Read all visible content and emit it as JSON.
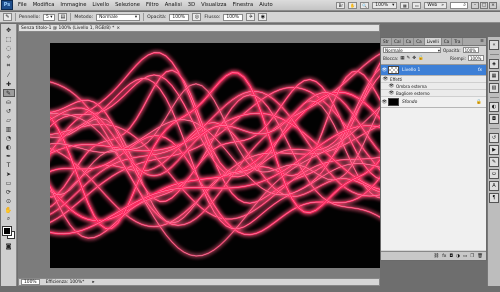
{
  "app": {
    "logo": "Ps",
    "menu": [
      "File",
      "Modifica",
      "Immagine",
      "Livello",
      "Selezione",
      "Filtro",
      "Analisi",
      "3D",
      "Visualizza",
      "Finestra",
      "Aiuto"
    ],
    "zoom_dropdown": "100%",
    "zoom_value": "100%",
    "workspace": "Web",
    "window_controls": [
      "–",
      "□",
      "×"
    ]
  },
  "options": {
    "brush_label": "Pennello:",
    "brush_size": "5",
    "mode_label": "Metodo:",
    "mode_value": "Normale",
    "opacity_label": "Opacità:",
    "opacity_value": "100%",
    "flow_label": "Flusso:",
    "flow_value": "100%"
  },
  "document": {
    "tab_title": "Senza titolo-1 @ 100% (Livello 1, RGB/8) *",
    "status_zoom": "100%",
    "status_text": "Efficienza: 100%*"
  },
  "layers_panel": {
    "tabs": [
      "Str",
      "Cal",
      "Ca",
      "Ca",
      "Livelli",
      "Ca",
      "Tra"
    ],
    "active_tab": "Livelli",
    "blend_mode": "Normale",
    "opacity_label": "Opacità:",
    "opacity_value": "100%",
    "lock_label": "Blocca:",
    "fill_label": "Riempi:",
    "fill_value": "100%",
    "layers": [
      {
        "name": "Livello 1",
        "selected": true,
        "has_fx": true
      },
      {
        "name": "Sfondo",
        "selected": false,
        "has_fx": false
      }
    ],
    "effects_label": "Effetti",
    "effects": [
      "Ombra esterna",
      "Bagliore esterno"
    ],
    "fx_symbol": "fx"
  },
  "colors": {
    "canvas_bg": "#020202",
    "light_trail_outer": "#ff1f5a",
    "light_trail_core": "#ffd0e0",
    "selection_blue": "#3d7fd6"
  }
}
